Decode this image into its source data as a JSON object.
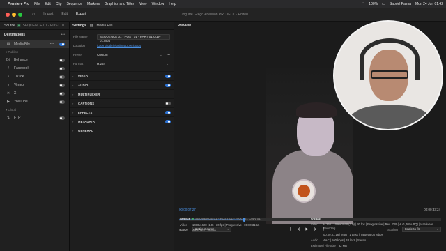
{
  "menubar": {
    "app": "Premiere Pro",
    "items": [
      "File",
      "Edit",
      "Clip",
      "Sequence",
      "Markers",
      "Graphics and Titles",
      "View",
      "Window",
      "Help"
    ],
    "user": "Sabriel Palma",
    "battery": "100%",
    "datetime": "Mon 24 Jun  01:42"
  },
  "header": {
    "tabs": [
      "Import",
      "Edit",
      "Export"
    ],
    "active_tab": "Export",
    "doc_title": "Jogurte Grego Abelinon PROJECT · Edited"
  },
  "left": {
    "source_label": "Source",
    "source_value": "SEQUENCE 01 - POST 01 - PART 01 C...",
    "destinations_title": "Destinations",
    "media_file": "Media File",
    "publish_label": "Publish",
    "publish_items": [
      "Behance",
      "Facebook",
      "TikTok",
      "Vimeo",
      "X",
      "YouTube"
    ],
    "cloud_label": "Cloud",
    "ftp_label": "FTP"
  },
  "settings": {
    "title": "Settings",
    "media_file": "Media File",
    "file_name_label": "File Name",
    "file_name_value": "SEQUENCE 01 - POST 01 - PART 01 Copy 01.mp4",
    "location_label": "Location",
    "location_value": "/Users/sabrielpalma/Downloads",
    "preset_label": "Preset",
    "preset_value": "Custom",
    "format_label": "Format",
    "format_value": "H.264",
    "sections": [
      "VIDEO",
      "AUDIO",
      "MULTIPLEXER",
      "CAPTIONS",
      "EFFECTS",
      "METADATA",
      "GENERAL"
    ]
  },
  "preview": {
    "title": "Preview",
    "timecode_current": "00:00:07:27",
    "timecode_total": "00:00:33:24",
    "playhead_fraction": 0.245,
    "range_label": "Range",
    "range_value": "Entire Source",
    "scaling_label": "Scaling",
    "scaling_value": "Scale to fit"
  },
  "summary": {
    "source_title": "Source",
    "source_name": "SEQUENCE 01 - POST 01 - PART 01 Copy 01",
    "video_key": "Video",
    "source_video": "1080x1920 (1.0)  |  30 fps  |  Progressive  |  00:00:31:16",
    "audio_key": "Audio",
    "source_audio": "48000 Hz  |  Stereo",
    "output_title": "Output",
    "output_video": "H.264  |  1080x1920 (1.0)  |  30 fps  |  Progressive  |  Rec. 709 (HLG, 58% PQ)  |  Hardware Encoding",
    "output_video_2": "00:00:31:16  |  VBR  |  1 pass  |  Target 8.00 Mbps",
    "output_audio": "AAC  |  160 kbps  |  48 kHz  |  Stereo",
    "size_key": "Estimated File Size",
    "size_value": "32 MB"
  },
  "colors": {
    "accent": "#2d74d6",
    "link": "#4a90e2",
    "traffic_red": "#ff5f57",
    "traffic_yellow": "#febc2e",
    "traffic_green": "#28c840"
  }
}
